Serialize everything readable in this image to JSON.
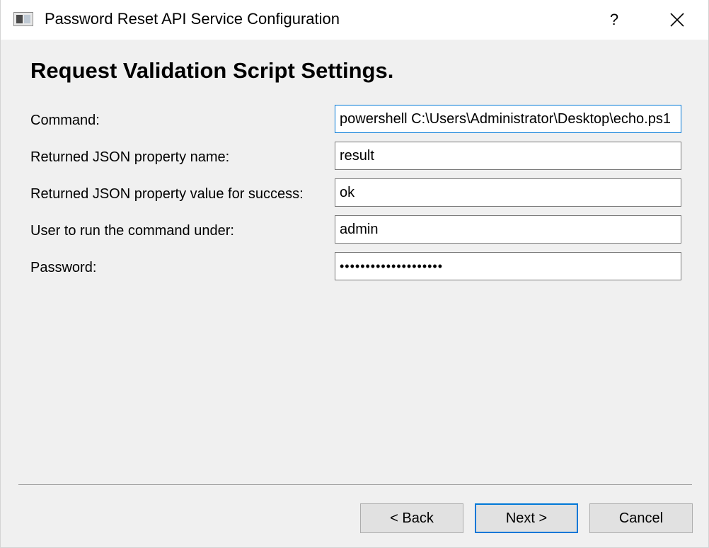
{
  "window": {
    "title": "Password Reset API Service Configuration",
    "help_label": "?"
  },
  "page": {
    "heading": "Request Validation Script Settings."
  },
  "form": {
    "command": {
      "label": "Command:",
      "value": "powershell C:\\Users\\Administrator\\Desktop\\echo.ps1"
    },
    "property_name": {
      "label": "Returned JSON property name:",
      "value": "result"
    },
    "property_value": {
      "label": "Returned JSON property value for success:",
      "value": "ok"
    },
    "user": {
      "label": "User to run the command under:",
      "value": "admin"
    },
    "password": {
      "label": "Password:",
      "value": "••••••••••••••••••••"
    }
  },
  "buttons": {
    "back": "< Back",
    "next": "Next >",
    "cancel": "Cancel"
  },
  "colors": {
    "focus_accent": "#0078d7",
    "window_bg": "#f0f0f0",
    "titlebar_bg": "#ffffff"
  }
}
